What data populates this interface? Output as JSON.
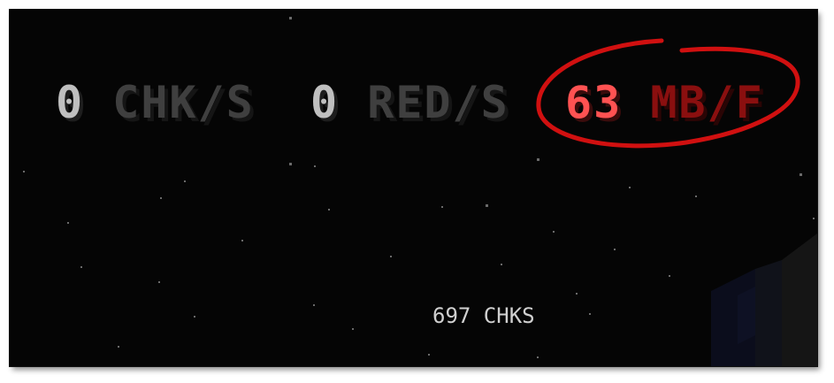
{
  "stats": {
    "chunks": {
      "value": "0",
      "unit": "CHK/S"
    },
    "redraws": {
      "value": "0",
      "unit": "RED/S"
    },
    "memory": {
      "value": "63",
      "unit": "MB/F"
    }
  },
  "footer": {
    "total_chunks": "697 CHKS"
  },
  "colors": {
    "background": "#050505",
    "stat_value": "#bfbfbf",
    "stat_unit": "#3f3f3f",
    "memory_value": "#ff5252",
    "memory_unit": "#8a0f0f",
    "annotation_circle": "#d01010"
  }
}
